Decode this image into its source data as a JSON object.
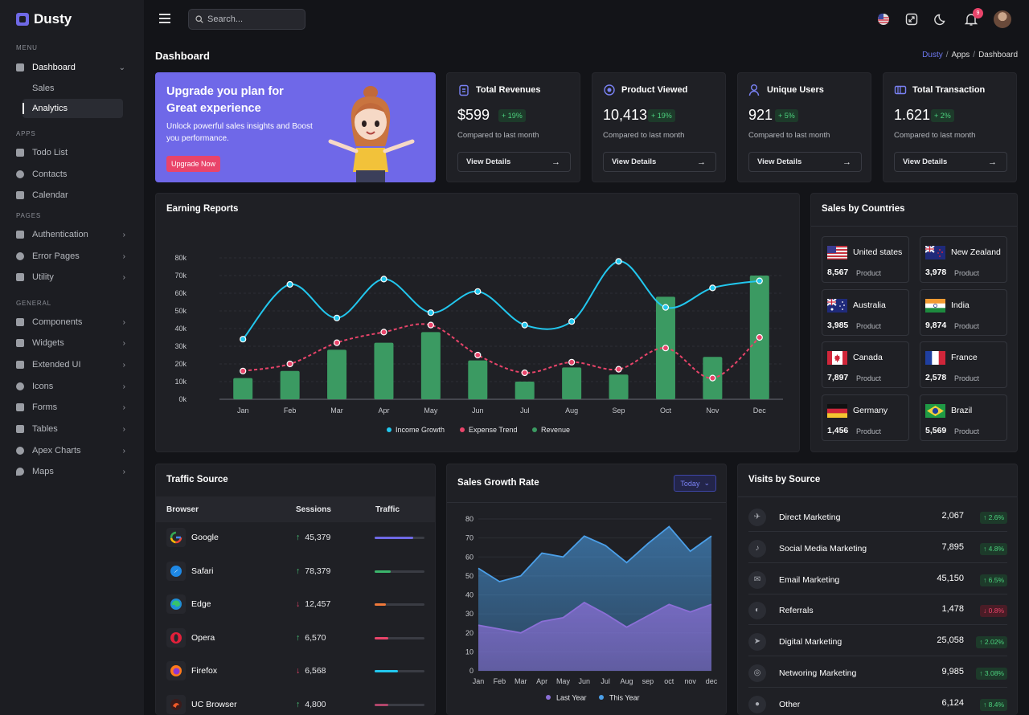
{
  "app": {
    "name": "Dusty"
  },
  "sidebar": {
    "sections": {
      "menu": "MENU",
      "apps": "APPS",
      "pages": "PAGES",
      "general": "GENERAL"
    },
    "dashboard": "Dashboard",
    "dashboard_sub": [
      "Sales",
      "Analytics"
    ],
    "apps": [
      "Todo List",
      "Contacts",
      "Calendar"
    ],
    "pages": [
      "Authentication",
      "Error Pages",
      "Utility"
    ],
    "general": [
      "Components",
      "Widgets",
      "Extended UI",
      "Icons",
      "Forms",
      "Tables",
      "Apex Charts",
      "Maps"
    ]
  },
  "topbar": {
    "search_placeholder": "Search...",
    "notification_count": "9"
  },
  "page": {
    "title": "Dashboard",
    "breadcrumb": [
      "Dusty",
      "Apps",
      "Dashboard"
    ]
  },
  "promo": {
    "heading": "Upgrade you plan for Great experience",
    "text": "Unlock powerful sales insights and Boost you performance.",
    "button": "Upgrade Now"
  },
  "stats": [
    {
      "title": "Total Revenues",
      "value": "$599",
      "change": "+ 19%",
      "compare": "Compared to last month",
      "action": "View Details"
    },
    {
      "title": "Product Viewed",
      "value": "10,413",
      "change": "+ 19%",
      "compare": "Compared to last month",
      "action": "View Details"
    },
    {
      "title": "Unique Users",
      "value": "921",
      "change": "+ 5%",
      "compare": "Compared to last month",
      "action": "View Details"
    },
    {
      "title": "Total Transaction",
      "value": "1.621",
      "change": "+ 2%",
      "compare": "Compared to last month",
      "action": "View Details"
    }
  ],
  "earning": {
    "title": "Earning Reports"
  },
  "countries": {
    "title": "Sales by Countries",
    "unit": "Product",
    "items": [
      {
        "name": "United states",
        "value": "8,567",
        "flag": "us-flag"
      },
      {
        "name": "New Zealand",
        "value": "3,978",
        "flag": "nz-flag"
      },
      {
        "name": "Australia",
        "value": "3,985",
        "flag": "au-flag"
      },
      {
        "name": "India",
        "value": "9,874",
        "flag": "in-flag"
      },
      {
        "name": "Canada",
        "value": "7,897",
        "flag": "ca-flag"
      },
      {
        "name": "France",
        "value": "2,578",
        "flag": "fr-flag"
      },
      {
        "name": "Germany",
        "value": "1,456",
        "flag": "de-flag"
      },
      {
        "name": "Brazil",
        "value": "5,569",
        "flag": "br-flag"
      }
    ]
  },
  "traffic": {
    "title": "Traffic Source",
    "headers": [
      "Browser",
      "Sessions",
      "Traffic"
    ],
    "rows": [
      {
        "browser": "Google",
        "sessions": "45,379",
        "trend": "up",
        "traffic": 0.78,
        "color": "#6f69e6"
      },
      {
        "browser": "Safari",
        "sessions": "78,379",
        "trend": "up",
        "traffic": 0.33,
        "color": "#3bb56c"
      },
      {
        "browser": "Edge",
        "sessions": "12,457",
        "trend": "down",
        "traffic": 0.22,
        "color": "#f0793a"
      },
      {
        "browser": "Opera",
        "sessions": "6,570",
        "trend": "up",
        "traffic": 0.27,
        "color": "#e9446a"
      },
      {
        "browser": "Firefox",
        "sessions": "6,568",
        "trend": "down",
        "traffic": 0.47,
        "color": "#22c7ee"
      },
      {
        "browser": "UC Browser",
        "sessions": "4,800",
        "trend": "up",
        "traffic": 0.27,
        "color": "#b0456a"
      }
    ]
  },
  "sales_growth": {
    "title": "Sales Growth Rate",
    "filter": "Today"
  },
  "visits": {
    "title": "Visits by Source",
    "rows": [
      {
        "name": "Direct Marketing",
        "value": "2,067",
        "change": "2.6%",
        "trend": "up"
      },
      {
        "name": "Social Media Marketing",
        "value": "7,895",
        "change": "4.8%",
        "trend": "up"
      },
      {
        "name": "Email Marketing",
        "value": "45,150",
        "change": "6.5%",
        "trend": "up"
      },
      {
        "name": "Referrals",
        "value": "1,478",
        "change": "0.8%",
        "trend": "down"
      },
      {
        "name": "Digital Marketing",
        "value": "25,058",
        "change": "2.02%",
        "trend": "up"
      },
      {
        "name": "Networing Marketing",
        "value": "9,985",
        "change": "3.08%",
        "trend": "up"
      },
      {
        "name": "Other",
        "value": "6,124",
        "change": "8.4%",
        "trend": "up"
      }
    ]
  },
  "chart_data": [
    {
      "type": "bar",
      "categories": [
        "Jan",
        "Feb",
        "Mar",
        "Apr",
        "May",
        "Jun",
        "Jul",
        "Aug",
        "Sep",
        "Oct",
        "Nov",
        "Dec"
      ],
      "yticks": [
        "0k",
        "10k",
        "20k",
        "30k",
        "40k",
        "50k",
        "60k",
        "70k",
        "80k"
      ],
      "ylim": [
        0,
        80000
      ],
      "series": [
        {
          "name": "Income Growth",
          "type": "line",
          "color": "#22c7ee",
          "values": [
            34000,
            65000,
            46000,
            68000,
            49000,
            61000,
            42000,
            44000,
            78000,
            52000,
            63000,
            67000
          ]
        },
        {
          "name": "Expense Trend",
          "type": "line",
          "dashed": true,
          "color": "#e9446a",
          "values": [
            16000,
            20000,
            32000,
            38000,
            42000,
            25000,
            15000,
            21000,
            17000,
            29000,
            12000,
            35000
          ]
        },
        {
          "name": "Revenue",
          "type": "bar",
          "color": "#3b9a62",
          "values": [
            12000,
            16000,
            28000,
            32000,
            38000,
            22000,
            10000,
            18000,
            14000,
            58000,
            24000,
            70000
          ]
        }
      ],
      "legend": "bottom"
    },
    {
      "type": "area",
      "categories": [
        "Jan",
        "Feb",
        "Mar",
        "Apr",
        "May",
        "Jun",
        "Jul",
        "Aug",
        "sep",
        "oct",
        "nov",
        "dec"
      ],
      "yticks": [
        "0",
        "10",
        "20",
        "30",
        "40",
        "50",
        "60",
        "70",
        "80"
      ],
      "ylim": [
        0,
        80
      ],
      "series": [
        {
          "name": "Last Year",
          "color": "#8b6fd6",
          "values": [
            24,
            22,
            20,
            26,
            28,
            36,
            30,
            23,
            29,
            35,
            31,
            35
          ]
        },
        {
          "name": "This Year",
          "color": "#4b9fe8",
          "values": [
            54,
            47,
            50,
            62,
            60,
            71,
            66,
            57,
            67,
            76,
            63,
            71
          ]
        }
      ],
      "legend": "bottom"
    }
  ]
}
